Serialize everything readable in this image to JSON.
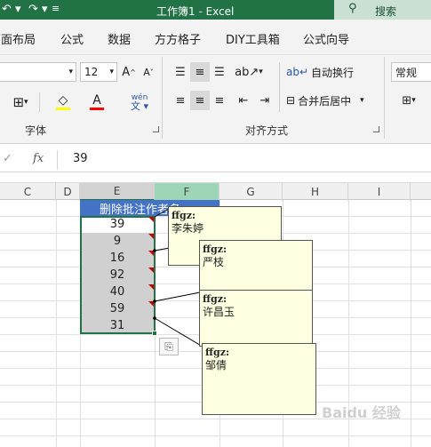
{
  "title_bar": {
    "window_title": "工作簿1  -  Excel",
    "search_label": "搜索"
  },
  "ribbon_tabs": [
    "页面布局",
    "公式",
    "数据",
    "方方格子",
    "DIY工具箱",
    "公式向导"
  ],
  "ribbon": {
    "font_size": "12",
    "font_group_label": "字体",
    "wrap_text_label": "自动换行",
    "merge_center_label": "合并后居中",
    "alignment_group_label": "对齐方式",
    "number_format": "常规",
    "phonetic_label": "wén\n文"
  },
  "formula_bar": {
    "fx_label": "fx",
    "value": "39"
  },
  "columns": [
    "C",
    "D",
    "E",
    "F",
    "G",
    "H",
    "I"
  ],
  "cells": {
    "header": "删除批注作者名",
    "values": [
      "39",
      "9",
      "16",
      "92",
      "40",
      "59",
      "31"
    ]
  },
  "comments": [
    {
      "author": "ffgz:",
      "text": "李朱婷"
    },
    {
      "author": "ffgz:",
      "text": "严枝"
    },
    {
      "author": "ffgz:",
      "text": "许昌玉"
    },
    {
      "author": "ffgz:",
      "text": "邹倩"
    }
  ],
  "watermark": "Baidu 经验",
  "colors": {
    "excel_green": "#217346",
    "selected_header_green": "#9fd5b7",
    "cell_blue": "#4472c4",
    "comment_yellow": "#ffffe1",
    "comment_indicator_red": "#c00000"
  },
  "icons": {
    "undo": "undo-icon",
    "redo": "redo-icon",
    "search": "search-icon",
    "paste_options": "paste-options-icon"
  }
}
